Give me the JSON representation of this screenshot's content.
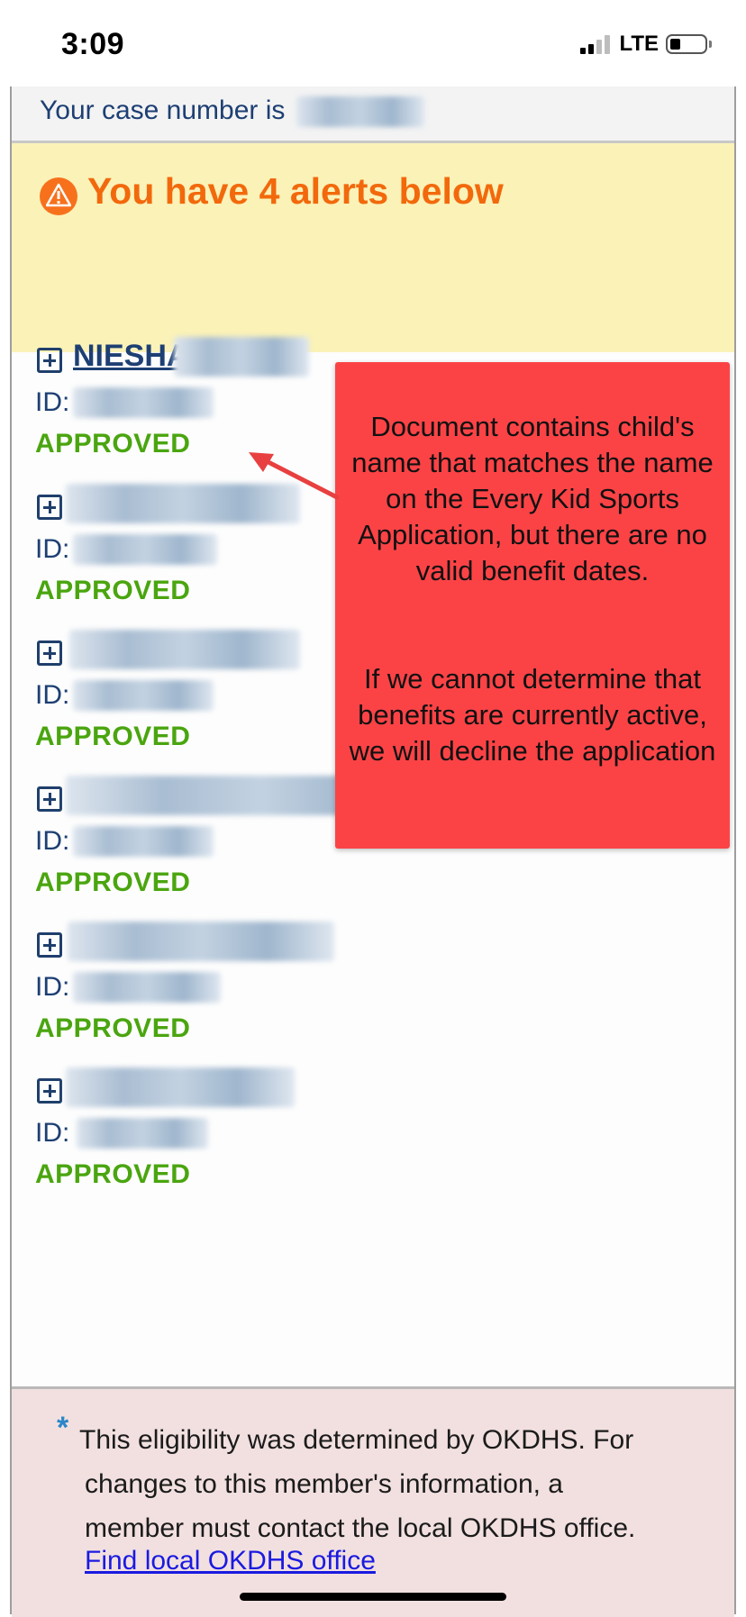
{
  "status_bar": {
    "time": "3:09",
    "network": "LTE"
  },
  "case": {
    "label": "Your case number is"
  },
  "alerts": {
    "text": "You have 4 alerts below",
    "color": "#f2690c"
  },
  "members": [
    {
      "name": "NIESHA",
      "id_label": "ID:",
      "status": "APPROVED"
    },
    {
      "name": "",
      "id_label": "ID:",
      "status": "APPROVED"
    },
    {
      "name": "",
      "id_label": "ID:",
      "status": "APPROVED"
    },
    {
      "name": "",
      "id_label": "ID:",
      "status": "APPROVED"
    },
    {
      "name": "",
      "id_label": "ID:",
      "status": "APPROVED"
    },
    {
      "name": "",
      "id_label": "ID:",
      "status": "APPROVED"
    }
  ],
  "callout": {
    "paragraph1": "Document contains child's name that matches the name on the Every Kid Sports Application, but there are no valid benefit dates.",
    "paragraph2": "If we cannot determine that benefits are currently active, we will decline the application",
    "color": "#fb4346"
  },
  "footer": {
    "asterisk": "*",
    "note_line1": "This eligibility was determined by OKDHS. For",
    "note_line2": "changes to this member's information, a",
    "note_line3": "member must contact the local OKDHS office.",
    "link": "Find local OKDHS office"
  },
  "colors": {
    "approved": "#4aa50f",
    "navy": "#1d3f73"
  }
}
